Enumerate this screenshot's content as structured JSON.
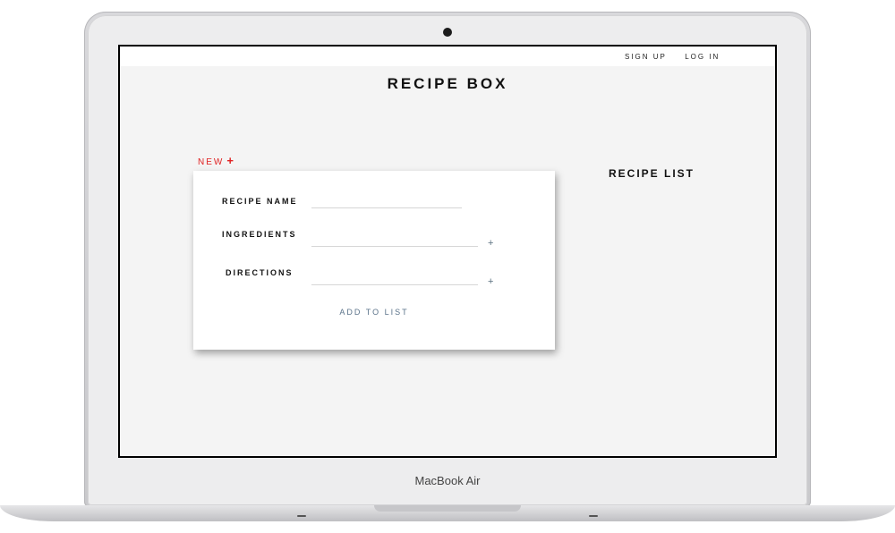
{
  "device": {
    "brand": "MacBook Air"
  },
  "nav": {
    "sign_up": "SIGN UP",
    "log_in": "LOG IN"
  },
  "app": {
    "title": "RECIPE BOX"
  },
  "form": {
    "new_label": "NEW",
    "new_icon": "+",
    "recipe_name_label": "RECIPE NAME",
    "recipe_name_value": "",
    "ingredients_label": "INGREDIENTS",
    "ingredients_value": "",
    "directions_label": "DIRECTIONS",
    "directions_value": "",
    "add_icon": "+",
    "submit_label": "ADD TO LIST"
  },
  "list": {
    "title": "RECIPE LIST"
  },
  "colors": {
    "accent_red": "#e02222",
    "submit_blue": "#5b738a"
  }
}
